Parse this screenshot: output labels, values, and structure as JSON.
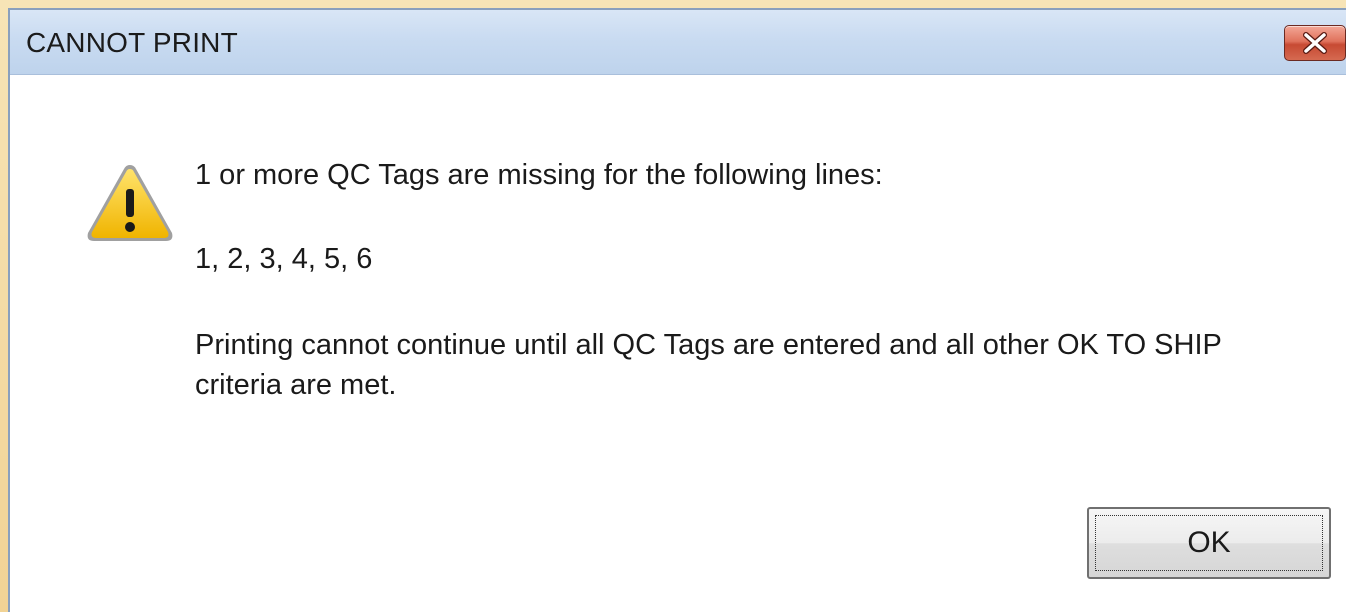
{
  "dialog": {
    "title": "CANNOT PRINT",
    "icon": "warning-icon",
    "message_line1": "1 or more QC Tags are missing for the following lines:",
    "missing_lines": "1, 2, 3, 4, 5, 6",
    "message_line3": "Printing cannot continue until all QC Tags are entered and all other OK TO SHIP criteria are met.",
    "ok_label": "OK",
    "close_icon": "close-icon"
  },
  "colors": {
    "titlebar": "#c9dbf1",
    "close_button": "#d56a51",
    "warning_fill": "#f5c400",
    "background_desktop": "#f4d9a0"
  }
}
